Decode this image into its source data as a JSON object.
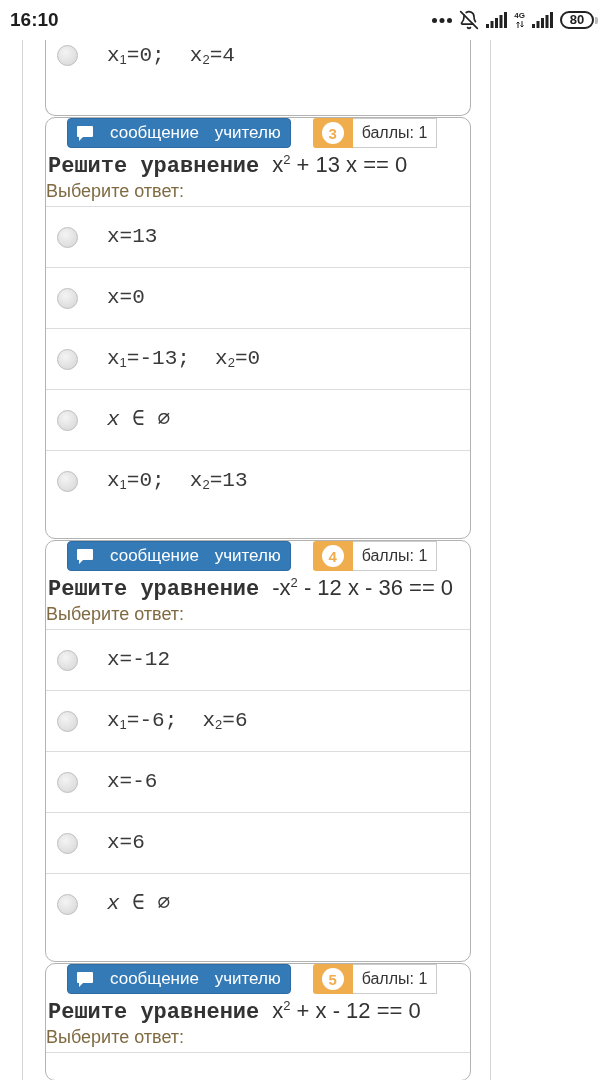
{
  "status_bar": {
    "time": "16:10",
    "network": "4G",
    "battery": "80"
  },
  "questions": [
    {
      "options": [
        {
          "text": "x$_{1}$=0;  x$_{2}$=4",
          "selected": false
        }
      ]
    },
    {
      "message_button": "сообщение учителю",
      "number": "3",
      "points": "баллы: 1",
      "prompt": "Решите уравнение",
      "equation": "x$^{2}$ + 13 x == 0",
      "instruction": "Выберите ответ:",
      "options": [
        {
          "text": "x=13",
          "selected": false
        },
        {
          "text": "x=0",
          "selected": false
        },
        {
          "text": "x$_{1}$=-13;  x$_{2}$=0",
          "selected": false
        },
        {
          "text": "*x* ∈ ∅",
          "selected": false
        },
        {
          "text": "x$_{1}$=0;  x$_{2}$=13",
          "selected": false
        }
      ]
    },
    {
      "message_button": "сообщение учителю",
      "number": "4",
      "points": "баллы: 1",
      "prompt": "Решите уравнение",
      "equation": "-x$^{2}$ - 12 x - 36 == 0",
      "instruction": "Выберите ответ:",
      "options": [
        {
          "text": "x=-12",
          "selected": false
        },
        {
          "text": "x$_{1}$=-6;  x$_{2}$=6",
          "selected": false
        },
        {
          "text": "x=-6",
          "selected": false
        },
        {
          "text": "x=6",
          "selected": false
        },
        {
          "text": "*x* ∈ ∅",
          "selected": false
        }
      ]
    },
    {
      "message_button": "сообщение учителю",
      "number": "5",
      "points": "баллы: 1",
      "prompt": "Решите уравнение",
      "equation": "x$^{2}$ + x - 12 == 0",
      "instruction": "Выберите ответ:"
    }
  ]
}
